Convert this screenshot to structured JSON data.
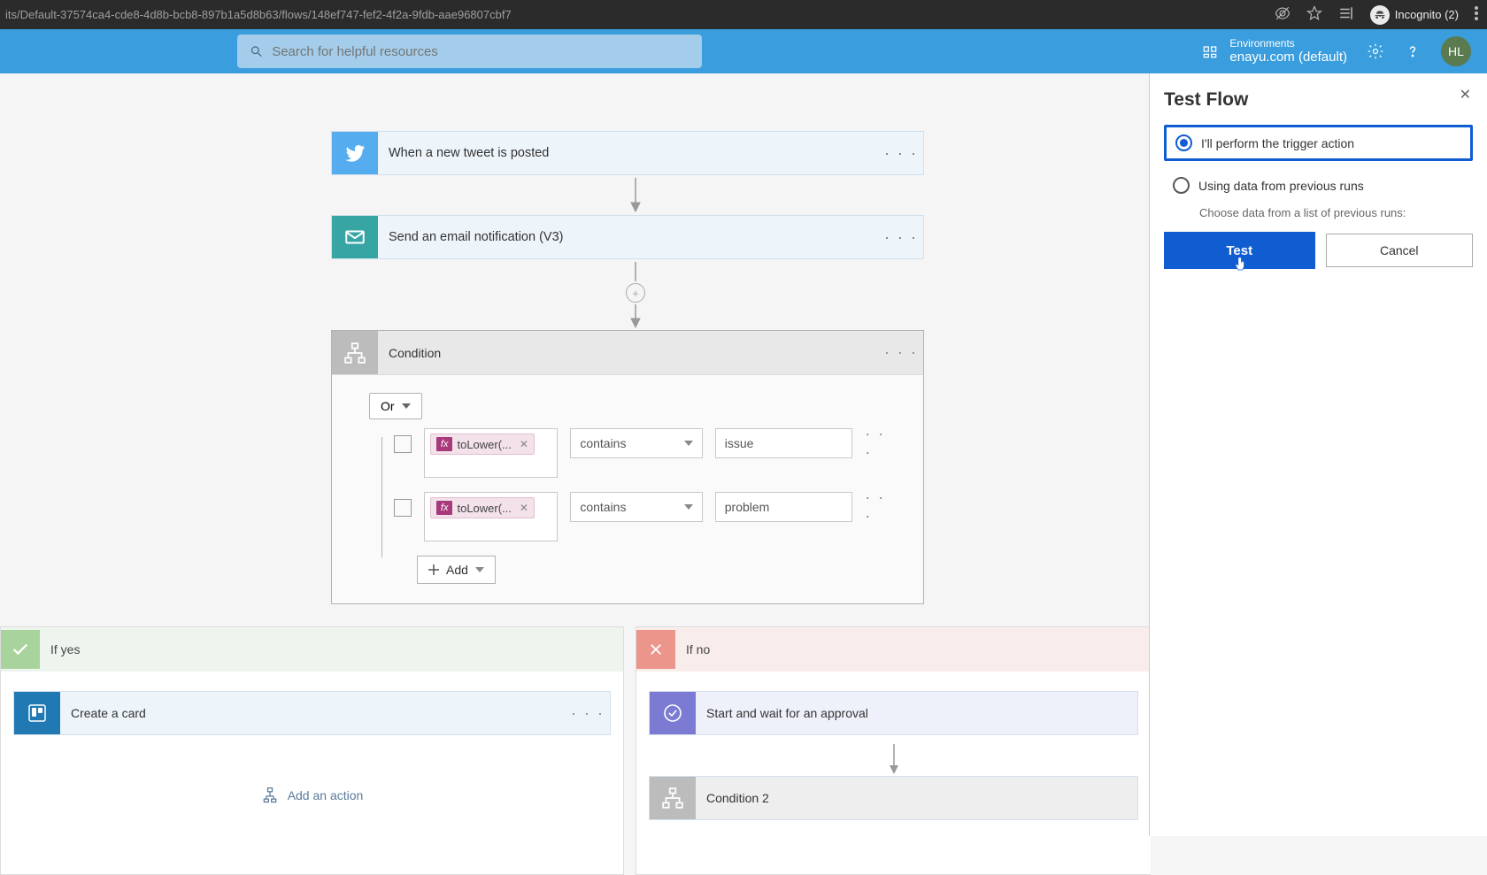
{
  "browser": {
    "url": "its/Default-37574ca4-cde8-4d8b-bcb8-897b1a5d8b63/flows/148ef747-fef2-4f2a-9fdb-aae96807cbf7",
    "incognito_label": "Incognito (2)"
  },
  "header": {
    "search_placeholder": "Search for helpful resources",
    "env_label": "Environments",
    "env_value": "enayu.com (default)",
    "profile_initials": "HL"
  },
  "flow": {
    "trigger": {
      "label": "When a new tweet is posted"
    },
    "action1": {
      "label": "Send an email notification (V3)"
    },
    "condition": {
      "title": "Condition",
      "operator": "Or",
      "rows": [
        {
          "token": "toLower(...",
          "op": "contains",
          "value": "issue"
        },
        {
          "token": "toLower(...",
          "op": "contains",
          "value": "problem"
        }
      ],
      "add_label": "Add"
    },
    "branches": {
      "yes": {
        "title": "If yes",
        "action": {
          "label": "Create a card"
        },
        "add_action": "Add an action"
      },
      "no": {
        "title": "If no",
        "action": {
          "label": "Start and wait for an approval"
        },
        "action2": {
          "label": "Condition 2"
        }
      }
    }
  },
  "panel": {
    "title": "Test Flow",
    "option1": "I'll perform the trigger action",
    "option2": "Using data from previous runs",
    "hint": "Choose data from a list of previous runs:",
    "test_btn": "Test",
    "cancel_btn": "Cancel"
  }
}
